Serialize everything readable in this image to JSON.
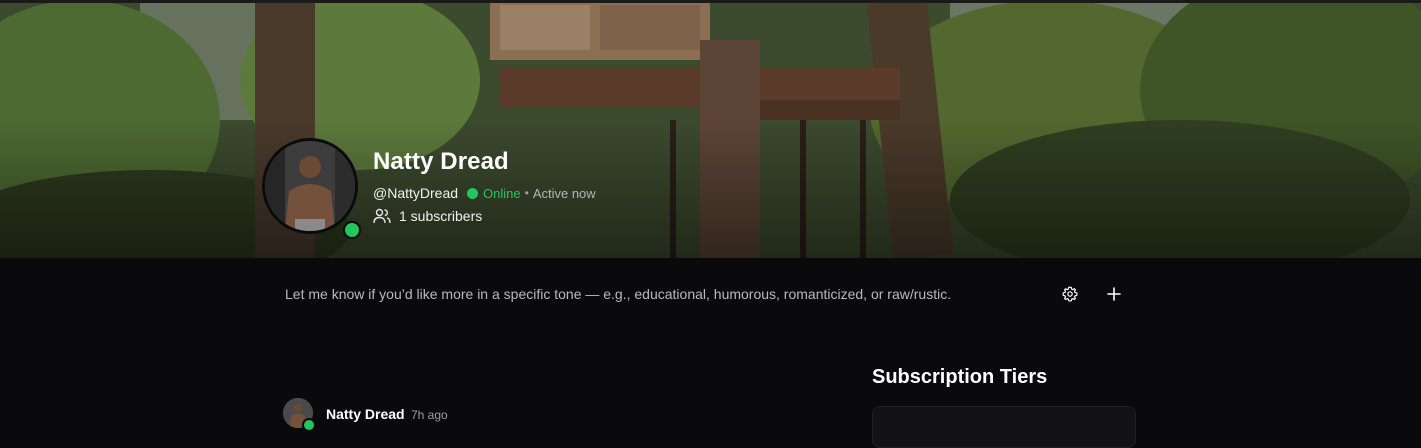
{
  "profile": {
    "name": "Natty Dread",
    "handle": "@NattyDread",
    "status": "Online",
    "activity": "Active now",
    "subscribers": "1 subscribers"
  },
  "bio": "Let me know if you’d like more in a specific tone — e.g., educational, humorous, romanticized, or raw/rustic.",
  "actions": {
    "settings_icon": "gear-icon",
    "add_icon": "plus-icon"
  },
  "sidebar": {
    "tiers_title": "Subscription Tiers"
  },
  "post": {
    "author": "Natty Dread",
    "time": "7h ago"
  },
  "colors": {
    "online": "#22c55e",
    "background": "#0a0a0d"
  }
}
